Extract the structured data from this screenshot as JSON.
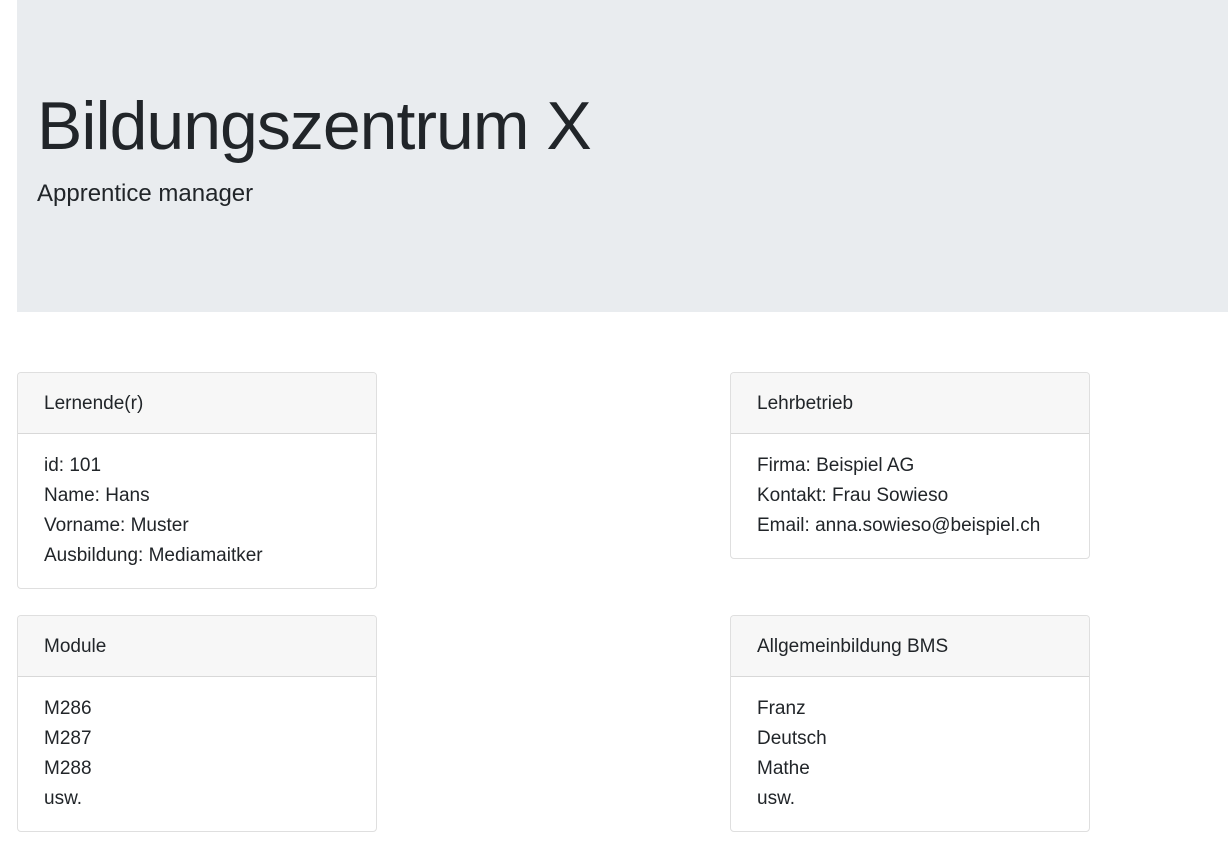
{
  "header": {
    "title": "Bildungszentrum X",
    "subtitle": "Apprentice manager"
  },
  "cards": {
    "lernende": {
      "title": "Lernende(r)",
      "lines": [
        "id: 101",
        "Name: Hans",
        "Vorname: Muster",
        "Ausbildung: Mediamaitker"
      ]
    },
    "lehrbetrieb": {
      "title": "Lehrbetrieb",
      "lines": [
        "Firma: Beispiel AG",
        "Kontakt: Frau Sowieso",
        "Email: anna.sowieso@beispiel.ch"
      ]
    },
    "module": {
      "title": "Module",
      "lines": [
        "M286",
        "M287",
        "M288",
        "usw."
      ]
    },
    "bms": {
      "title": "Allgemeinbildung BMS",
      "lines": [
        "Franz",
        "Deutsch",
        "Mathe",
        "usw."
      ]
    }
  },
  "colors": {
    "jumbotron_bg": "#e9ecef",
    "card_header_bg": "#f7f7f7",
    "text": "#212529"
  }
}
